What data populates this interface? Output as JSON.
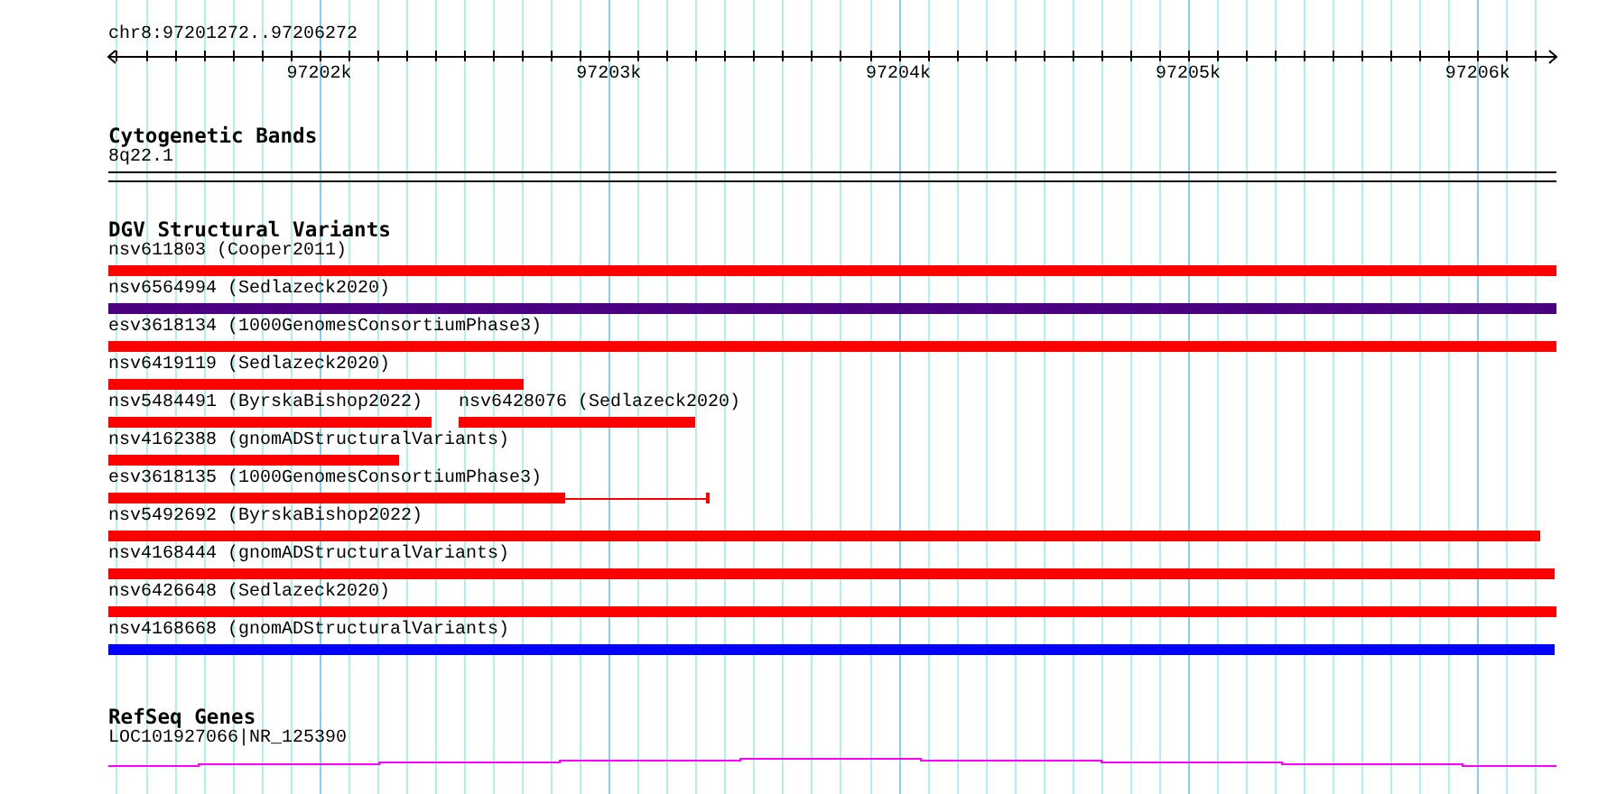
{
  "ruler": {
    "label": "chr8:97201272..97206272",
    "ticks": [
      {
        "label": "97202k",
        "level": 0.1456
      },
      {
        "label": "97203k",
        "level": 0.3456
      },
      {
        "label": "97204k",
        "level": 0.5456
      },
      {
        "label": "97205k",
        "level": 0.7456
      },
      {
        "label": "97206k",
        "level": 0.9456
      }
    ]
  },
  "cytogenetic_bands": {
    "title": "Cytogenetic Bands",
    "band": "8q22.1"
  },
  "dgv_structural_variants": {
    "title": "DGV Structural Variants",
    "rows": [
      {
        "features": [
          {
            "label": "nsv611803 (Cooper2011)",
            "color": "#ff0000",
            "kind": "block"
          }
        ]
      },
      {
        "features": [
          {
            "label": "nsv6564994 (Sedlazeck2020)",
            "color": "#4b0082",
            "kind": "block"
          }
        ]
      },
      {
        "features": [
          {
            "label": "esv3618134 (1000GenomesConsortiumPhase3)",
            "color": "#ff0000",
            "kind": "block"
          }
        ]
      },
      {
        "features": [
          {
            "label": "nsv6419119 (Sedlazeck2020)",
            "color": "#ff0000",
            "kind": "block"
          }
        ]
      },
      {
        "features": [
          {
            "label": "nsv5484491 (ByrskaBishop2022)",
            "color": "#ff0000",
            "kind": "block"
          },
          {
            "label": "nsv6428076 (Sedlazeck2020)",
            "color": "#ff0000",
            "kind": "block"
          }
        ]
      },
      {
        "features": [
          {
            "label": "nsv4162388 (gnomADStructuralVariants)",
            "color": "#ff0000",
            "kind": "block"
          }
        ]
      },
      {
        "features": [
          {
            "label": "esv3618135 (1000GenomesConsortiumPhase3)",
            "color": "#ff0000",
            "kind": "tailed"
          }
        ]
      },
      {
        "features": [
          {
            "label": "nsv5492692 (ByrskaBishop2022)",
            "color": "#ff0000",
            "kind": "block"
          }
        ]
      },
      {
        "features": [
          {
            "label": "nsv4168444 (gnomADStructuralVariants)",
            "color": "#ff0000",
            "kind": "block"
          }
        ]
      },
      {
        "features": [
          {
            "label": "nsv6426648 (Sedlazeck2020)",
            "color": "#ff0000",
            "kind": "block"
          }
        ]
      },
      {
        "features": [
          {
            "label": "nsv4168668 (gnomADStructuralVariants)",
            "color": "#0000ff",
            "kind": "block"
          }
        ]
      }
    ]
  },
  "refseq_genes": {
    "title": "RefSeq Genes",
    "genes": [
      {
        "label": "LOC101927066|NR_125390"
      }
    ]
  }
}
